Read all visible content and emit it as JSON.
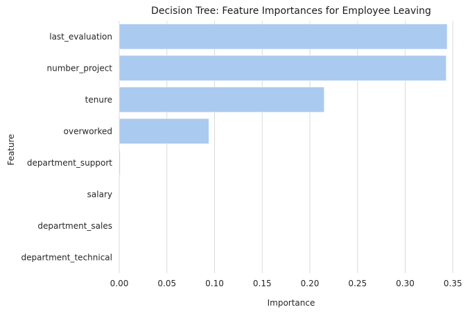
{
  "chart_data": {
    "type": "bar",
    "orientation": "horizontal",
    "title": "Decision Tree: Feature Importances for Employee Leaving",
    "xlabel": "Importance",
    "ylabel": "Feature",
    "categories": [
      "last_evaluation",
      "number_project",
      "tenure",
      "overworked",
      "department_support",
      "salary",
      "department_sales",
      "department_technical"
    ],
    "values": [
      0.344,
      0.343,
      0.215,
      0.094,
      0.001,
      0.0,
      0.0,
      0.0
    ],
    "xlim": [
      0,
      0.36
    ],
    "xticks": [
      0.0,
      0.05,
      0.1,
      0.15,
      0.2,
      0.25,
      0.3,
      0.35
    ],
    "xtick_labels": [
      "0.00",
      "0.05",
      "0.10",
      "0.15",
      "0.20",
      "0.25",
      "0.30",
      "0.35"
    ],
    "grid": "vertical",
    "bar_color": "#abcaef",
    "grid_color": "#d9d9d9"
  }
}
